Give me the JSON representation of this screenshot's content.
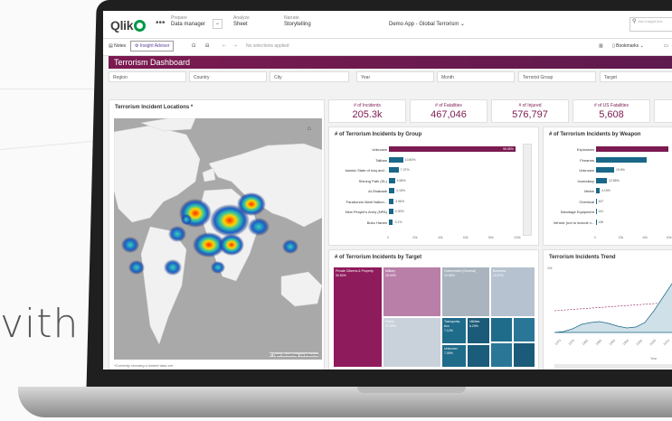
{
  "page": {
    "hero_text": "vith"
  },
  "topbar": {
    "logo": "Qlik",
    "menu": "•••",
    "prepare": {
      "label": "Prepare",
      "value": "Data manager"
    },
    "analyze": {
      "label": "Analyze",
      "value": "Sheet"
    },
    "narrate": {
      "label": "Narrate",
      "value": "Storytelling"
    },
    "app_title": "Demo App - Global Terrorism  ⌄",
    "search_placeholder": "Ask Insight Adv"
  },
  "toolbar": {
    "notes": "Notes",
    "insight": "Insight Advisor",
    "selections": "No selections applied",
    "bookmarks": "Bookmarks ⌄"
  },
  "dashboard": {
    "title": "Terrorism Dashboard"
  },
  "filters": [
    "Region",
    "Country",
    "City",
    "Year",
    "Month",
    "Terrorist Group",
    "Target"
  ],
  "map": {
    "title": "Terrorism Incident Locations *",
    "credit": "© OpenStreetMap contributors",
    "footnote": "*Currently showing a limited data set."
  },
  "kpis": [
    {
      "label": "# of Incidents",
      "value": "205.3k"
    },
    {
      "label": "# of Fatalities",
      "value": "467,046"
    },
    {
      "label": "# of Injured",
      "value": "576,797"
    },
    {
      "label": "# of US Fatalities",
      "value": "5,608"
    }
  ],
  "group_chart": {
    "title": "# of Terrorism Incidents by Group",
    "bars": [
      {
        "label": "Unknown",
        "pct": "96.55%",
        "value": 96.55,
        "highlight": true
      },
      {
        "label": "Taliban",
        "pct": "10.80%",
        "value": 10.8
      },
      {
        "label": "Islamic State of Iraq and...",
        "pct": "7.37%",
        "value": 7.37
      },
      {
        "label": "Shining Path (SL)",
        "pct": "4.58%",
        "value": 4.58
      },
      {
        "label": "Al-Shabaab",
        "pct": "4.16%",
        "value": 4.16
      },
      {
        "label": "Farabundo Marti Nation...",
        "pct": "3.56%",
        "value": 3.56
      },
      {
        "label": "New People's Army (NPA)",
        "pct": "3.30%",
        "value": 3.3
      },
      {
        "label": "Boko Haram",
        "pct": "3.1%",
        "value": 3.1
      }
    ],
    "ticks": [
      "0",
      "20k",
      "40k",
      "60k",
      "80k",
      "100k"
    ]
  },
  "weapon_chart": {
    "title": "# of Terrorism Incidents by Weapon",
    "bars": [
      {
        "label": "Explosives",
        "pct": "",
        "value": 100,
        "highlight": true
      },
      {
        "label": "Firearms",
        "pct": "",
        "value": 70
      },
      {
        "label": "Unknown",
        "pct": "19.5%",
        "value": 25
      },
      {
        "label": "Incendiary",
        "pct": "12.85%",
        "value": 15
      },
      {
        "label": "Melee",
        "pct": "4.15%",
        "value": 5
      },
      {
        "label": "Chemical",
        "pct": "347",
        "value": 0.5
      },
      {
        "label": "Sabotage Equipment",
        "pct": "141",
        "value": 0.3
      },
      {
        "label": "Vehicle (not to include v...",
        "pct": "136",
        "value": 0.3
      }
    ],
    "ticks": [
      "0",
      "20k",
      "40k",
      "60k"
    ]
  },
  "target_chart": {
    "title": "# of Terrorism Incidents by Target",
    "cells": [
      {
        "label": "Private Citizens & Property",
        "pct": "30.84%"
      },
      {
        "label": "Military",
        "pct": "15.93%"
      },
      {
        "label": "Government (General)",
        "pct": "10.65%"
      },
      {
        "label": "Business",
        "pct": "10.97%"
      },
      {
        "label": "Police",
        "pct": "27.04%"
      },
      {
        "label": "Transporta- tion",
        "pct": "7.12%"
      },
      {
        "label": "Utilities",
        "pct": "6.29%"
      },
      {
        "label": "Unknown",
        "pct": "7.05%"
      }
    ]
  },
  "trend_chart": {
    "title": "Terrorism Incidents Trend",
    "y_tick": "20k",
    "x_label": "Year",
    "x_ticks": [
      "1970",
      "1975",
      "1980",
      "1985",
      "1990",
      "1995",
      "2000",
      "2005",
      "2010"
    ]
  },
  "colors": {
    "brand_green": "#009845",
    "maroon": "#7b1a50",
    "teal": "#1a6788"
  }
}
